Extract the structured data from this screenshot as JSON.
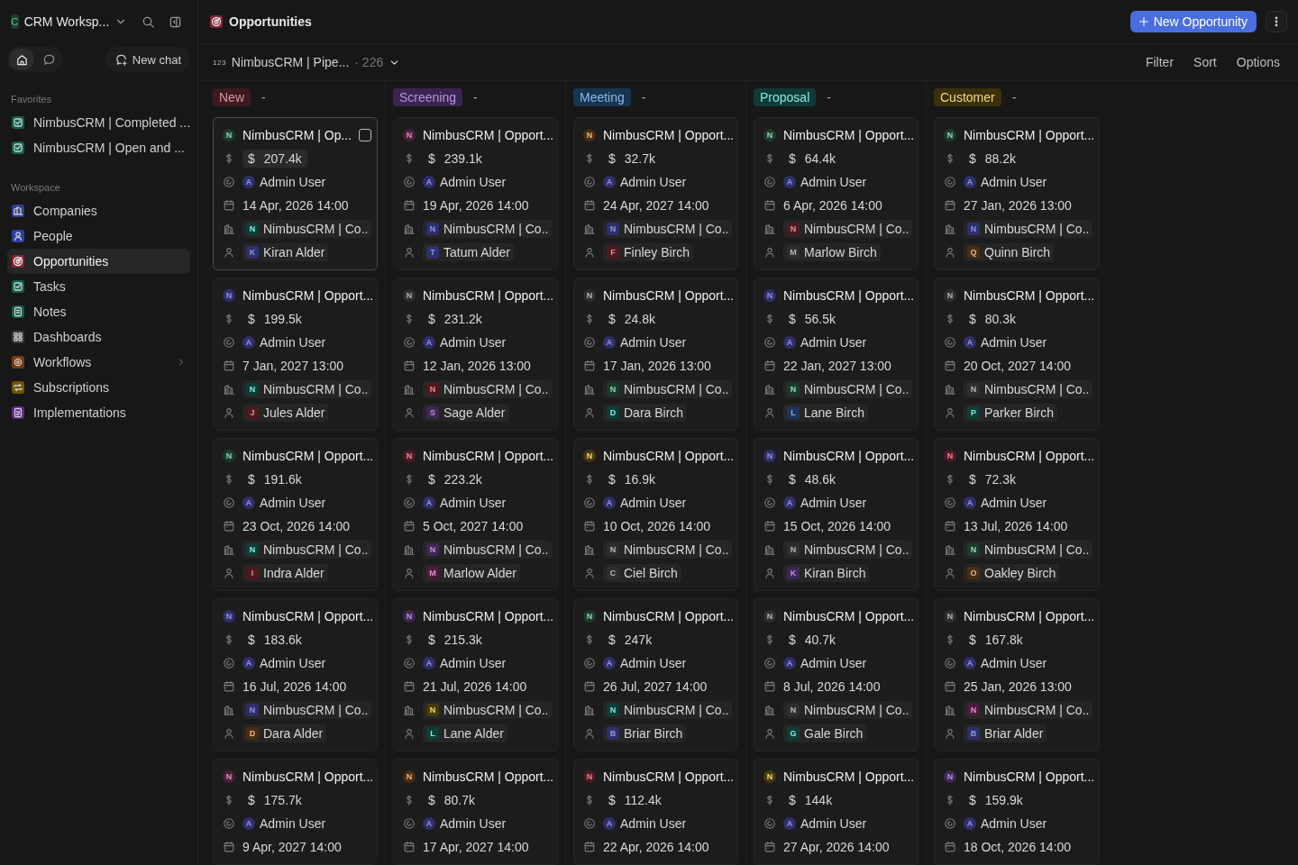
{
  "workspace": {
    "initial": "C",
    "name": "CRM Worksp..."
  },
  "sidebar": {
    "modes": [
      {
        "kind": "home",
        "selected": true
      },
      {
        "kind": "chat",
        "selected": false
      }
    ],
    "new_chat": "New chat",
    "favorites_label": "Favorites",
    "favorites": [
      {
        "label": "NimbusCRM | Completed ..."
      },
      {
        "label": "NimbusCRM | Open and ..."
      }
    ],
    "workspace_label": "Workspace",
    "items": [
      {
        "label": "Companies",
        "color": "#2f3f8f",
        "selected": false,
        "expandable": false
      },
      {
        "label": "People",
        "color": "#2c40a0",
        "selected": false,
        "expandable": false
      },
      {
        "label": "Opportunities",
        "color": "#8a2233",
        "selected": true,
        "expandable": false
      },
      {
        "label": "Tasks",
        "color": "#11604f",
        "selected": false,
        "expandable": false
      },
      {
        "label": "Notes",
        "color": "#0f5a48",
        "selected": false,
        "expandable": false
      },
      {
        "label": "Dashboards",
        "color": "#3a3a3a",
        "selected": false,
        "expandable": false
      },
      {
        "label": "Workflows",
        "color": "#7a3a10",
        "selected": false,
        "expandable": true
      },
      {
        "label": "Subscriptions",
        "color": "#6e5208",
        "selected": false,
        "expandable": false
      },
      {
        "label": "Implementations",
        "color": "#5a2a86",
        "selected": false,
        "expandable": false
      }
    ]
  },
  "header": {
    "title": "Opportunities",
    "new_button": "New Opportunity"
  },
  "view_bar": {
    "view_icon": "123",
    "view_name": "NimbusCRM | Pipe...",
    "count": "· 226",
    "actions": [
      "Filter",
      "Sort",
      "Options"
    ]
  },
  "currency": "$",
  "columns": [
    {
      "label": "New",
      "color": "#3d1a1e",
      "aggregate": "-",
      "cards": [
        {
          "hovered": true,
          "initial": "N",
          "color": "#1c3b2a",
          "title": "NimbusCRM | Op...",
          "amount": "207.4k",
          "owner": {
            "initial": "A",
            "color": "#2e2f6b",
            "name": "Admin User"
          },
          "date": "14 Apr, 2026 14:00",
          "company": {
            "initial": "N",
            "color": "#0f3d38",
            "name": "NimbusCRM | Co.."
          },
          "contact": {
            "initial": "K",
            "color": "#2e2f6b",
            "name": "Kiran Alder"
          }
        },
        {
          "hovered": false,
          "initial": "N",
          "color": "#2e2f6b",
          "title": "NimbusCRM | Opport...",
          "amount": "199.5k",
          "owner": {
            "initial": "A",
            "color": "#2e2f6b",
            "name": "Admin User"
          },
          "date": "7 Jan, 2027 13:00",
          "company": {
            "initial": "N",
            "color": "#0f3d38",
            "name": "NimbusCRM | Co.."
          },
          "contact": {
            "initial": "J",
            "color": "#4d1a20",
            "name": "Jules Alder"
          }
        },
        {
          "hovered": false,
          "initial": "N",
          "color": "#1c3b2a",
          "title": "NimbusCRM | Opport...",
          "amount": "191.6k",
          "owner": {
            "initial": "A",
            "color": "#2e2f6b",
            "name": "Admin User"
          },
          "date": "23 Oct, 2026 14:00",
          "company": {
            "initial": "N",
            "color": "#0f3d38",
            "name": "NimbusCRM | Co.."
          },
          "contact": {
            "initial": "I",
            "color": "#4d1a20",
            "name": "Indra Alder"
          }
        },
        {
          "hovered": false,
          "initial": "N",
          "color": "#2e2f6b",
          "title": "NimbusCRM | Opport...",
          "amount": "183.6k",
          "owner": {
            "initial": "A",
            "color": "#2e2f6b",
            "name": "Admin User"
          },
          "date": "16 Jul, 2026 14:00",
          "company": {
            "initial": "N",
            "color": "#2e2f6b",
            "name": "NimbusCRM | Co.."
          },
          "contact": {
            "initial": "D",
            "color": "#4a2c12",
            "name": "Dara Alder"
          }
        },
        {
          "hovered": false,
          "initial": "N",
          "color": "#4a1d3a",
          "title": "NimbusCRM | Opport...",
          "amount": "175.7k",
          "owner": {
            "initial": "A",
            "color": "#2e2f6b",
            "name": "Admin User"
          },
          "date": "9 Apr, 2027 14:00"
        }
      ]
    },
    {
      "label": "Screening",
      "color": "#3a2452",
      "aggregate": "-",
      "cards": [
        {
          "hovered": false,
          "initial": "N",
          "color": "#4a1d3a",
          "title": "NimbusCRM | Opport...",
          "amount": "239.1k",
          "owner": {
            "initial": "A",
            "color": "#2e2f6b",
            "name": "Admin User"
          },
          "date": "19 Apr, 2026 14:00",
          "company": {
            "initial": "N",
            "color": "#2e2f6b",
            "name": "NimbusCRM | Co.."
          },
          "contact": {
            "initial": "T",
            "color": "#2e2f6b",
            "name": "Tatum Alder"
          }
        },
        {
          "hovered": false,
          "initial": "N",
          "color": "#2e2e2e",
          "title": "NimbusCRM | Opport...",
          "amount": "231.2k",
          "owner": {
            "initial": "A",
            "color": "#2e2f6b",
            "name": "Admin User"
          },
          "date": "12 Jan, 2026 13:00",
          "company": {
            "initial": "N",
            "color": "#4d1a20",
            "name": "NimbusCRM | Co.."
          },
          "contact": {
            "initial": "S",
            "color": "#3d2754",
            "name": "Sage Alder"
          }
        },
        {
          "hovered": false,
          "initial": "N",
          "color": "#4d1a20",
          "title": "NimbusCRM | Opport...",
          "amount": "223.2k",
          "owner": {
            "initial": "A",
            "color": "#2e2f6b",
            "name": "Admin User"
          },
          "date": "5 Oct, 2027 14:00",
          "company": {
            "initial": "N",
            "color": "#3d2754",
            "name": "NimbusCRM | Co.."
          },
          "contact": {
            "initial": "M",
            "color": "#4a1d3a",
            "name": "Marlow Alder"
          }
        },
        {
          "hovered": false,
          "initial": "N",
          "color": "#3d2754",
          "title": "NimbusCRM | Opport...",
          "amount": "215.3k",
          "owner": {
            "initial": "A",
            "color": "#2e2f6b",
            "name": "Admin User"
          },
          "date": "21 Jul, 2026 14:00",
          "company": {
            "initial": "N",
            "color": "#453a0c",
            "name": "NimbusCRM | Co.."
          },
          "contact": {
            "initial": "L",
            "color": "#0f3d38",
            "name": "Lane Alder"
          }
        },
        {
          "hovered": false,
          "initial": "N",
          "color": "#4a2c12",
          "title": "NimbusCRM | Opport...",
          "amount": "80.7k",
          "owner": {
            "initial": "A",
            "color": "#2e2f6b",
            "name": "Admin User"
          },
          "date": "17 Apr, 2027 14:00"
        }
      ]
    },
    {
      "label": "Meeting",
      "color": "#183552",
      "aggregate": "-",
      "cards": [
        {
          "hovered": false,
          "initial": "N",
          "color": "#4a2c12",
          "title": "NimbusCRM | Opport...",
          "amount": "32.7k",
          "owner": {
            "initial": "A",
            "color": "#2e2f6b",
            "name": "Admin User"
          },
          "date": "24 Apr, 2027 14:00",
          "company": {
            "initial": "N",
            "color": "#2e2f6b",
            "name": "NimbusCRM | Co.."
          },
          "contact": {
            "initial": "F",
            "color": "#4d1a20",
            "name": "Finley Birch"
          }
        },
        {
          "hovered": false,
          "initial": "N",
          "color": "#2e2e2e",
          "title": "NimbusCRM | Opport...",
          "amount": "24.8k",
          "owner": {
            "initial": "A",
            "color": "#2e2f6b",
            "name": "Admin User"
          },
          "date": "17 Jan, 2026 13:00",
          "company": {
            "initial": "N",
            "color": "#1c3b2a",
            "name": "NimbusCRM | Co.."
          },
          "contact": {
            "initial": "D",
            "color": "#0f3d38",
            "name": "Dara Birch"
          }
        },
        {
          "hovered": false,
          "initial": "N",
          "color": "#453a0c",
          "title": "NimbusCRM | Opport...",
          "amount": "16.9k",
          "owner": {
            "initial": "A",
            "color": "#2e2f6b",
            "name": "Admin User"
          },
          "date": "10 Oct, 2026 14:00",
          "company": {
            "initial": "N",
            "color": "#2e2e2e",
            "name": "NimbusCRM | Co.."
          },
          "contact": {
            "initial": "C",
            "color": "#2e2e2e",
            "name": "Ciel Birch"
          }
        },
        {
          "hovered": false,
          "initial": "N",
          "color": "#1c3b2a",
          "title": "NimbusCRM | Opport...",
          "amount": "247k",
          "owner": {
            "initial": "A",
            "color": "#2e2f6b",
            "name": "Admin User"
          },
          "date": "26 Jul, 2027 14:00",
          "company": {
            "initial": "N",
            "color": "#0f3d38",
            "name": "NimbusCRM | Co.."
          },
          "contact": {
            "initial": "B",
            "color": "#2e2f6b",
            "name": "Briar Birch"
          }
        },
        {
          "hovered": false,
          "initial": "N",
          "color": "#4d1a20",
          "title": "NimbusCRM | Opport...",
          "amount": "112.4k",
          "owner": {
            "initial": "A",
            "color": "#2e2f6b",
            "name": "Admin User"
          },
          "date": "22 Apr, 2026 14:00"
        }
      ]
    },
    {
      "label": "Proposal",
      "color": "#0f3a36",
      "aggregate": "-",
      "cards": [
        {
          "hovered": false,
          "initial": "N",
          "color": "#1c3b2a",
          "title": "NimbusCRM | Opport...",
          "amount": "64.4k",
          "owner": {
            "initial": "A",
            "color": "#2e2f6b",
            "name": "Admin User"
          },
          "date": "6 Apr, 2026 14:00",
          "company": {
            "initial": "N",
            "color": "#4d1a20",
            "name": "NimbusCRM | Co.."
          },
          "contact": {
            "initial": "M",
            "color": "#2e2e2e",
            "name": "Marlow Birch"
          }
        },
        {
          "hovered": false,
          "initial": "N",
          "color": "#2e2f6b",
          "title": "NimbusCRM | Opport...",
          "amount": "56.5k",
          "owner": {
            "initial": "A",
            "color": "#2e2f6b",
            "name": "Admin User"
          },
          "date": "22 Jan, 2027 13:00",
          "company": {
            "initial": "N",
            "color": "#1c3b2a",
            "name": "NimbusCRM | Co.."
          },
          "contact": {
            "initial": "L",
            "color": "#1d3557",
            "name": "Lane Birch"
          }
        },
        {
          "hovered": false,
          "initial": "N",
          "color": "#2e2f6b",
          "title": "NimbusCRM | Opport...",
          "amount": "48.6k",
          "owner": {
            "initial": "A",
            "color": "#2e2f6b",
            "name": "Admin User"
          },
          "date": "15 Oct, 2026 14:00",
          "company": {
            "initial": "N",
            "color": "#2e2e2e",
            "name": "NimbusCRM | Co.."
          },
          "contact": {
            "initial": "K",
            "color": "#3d2754",
            "name": "Kiran Birch"
          }
        },
        {
          "hovered": false,
          "initial": "N",
          "color": "#2e2e2e",
          "title": "NimbusCRM | Opport...",
          "amount": "40.7k",
          "owner": {
            "initial": "A",
            "color": "#2e2f6b",
            "name": "Admin User"
          },
          "date": "8 Jul, 2026 14:00",
          "company": {
            "initial": "N",
            "color": "#2e2e2e",
            "name": "NimbusCRM | Co.."
          },
          "contact": {
            "initial": "G",
            "color": "#0f3d38",
            "name": "Gale Birch"
          }
        },
        {
          "hovered": false,
          "initial": "N",
          "color": "#453a0c",
          "title": "NimbusCRM | Opport...",
          "amount": "144k",
          "owner": {
            "initial": "A",
            "color": "#2e2f6b",
            "name": "Admin User"
          },
          "date": "27 Apr, 2026 14:00"
        }
      ]
    },
    {
      "label": "Customer",
      "color": "#3a300a",
      "aggregate": "-",
      "cards": [
        {
          "hovered": false,
          "initial": "N",
          "color": "#1c3b2a",
          "title": "NimbusCRM | Opport...",
          "amount": "88.2k",
          "owner": {
            "initial": "A",
            "color": "#2e2f6b",
            "name": "Admin User"
          },
          "date": "27 Jan, 2026 13:00",
          "company": {
            "initial": "N",
            "color": "#2e2f6b",
            "name": "NimbusCRM | Co.."
          },
          "contact": {
            "initial": "Q",
            "color": "#4a2c12",
            "name": "Quinn Birch"
          }
        },
        {
          "hovered": false,
          "initial": "N",
          "color": "#2e2e2e",
          "title": "NimbusCRM | Opport...",
          "amount": "80.3k",
          "owner": {
            "initial": "A",
            "color": "#2e2f6b",
            "name": "Admin User"
          },
          "date": "20 Oct, 2027 14:00",
          "company": {
            "initial": "N",
            "color": "#2e2e2e",
            "name": "NimbusCRM | Co.."
          },
          "contact": {
            "initial": "P",
            "color": "#0f3d38",
            "name": "Parker Birch"
          }
        },
        {
          "hovered": false,
          "initial": "N",
          "color": "#4d1a20",
          "title": "NimbusCRM | Opport...",
          "amount": "72.3k",
          "owner": {
            "initial": "A",
            "color": "#2e2f6b",
            "name": "Admin User"
          },
          "date": "13 Jul, 2026 14:00",
          "company": {
            "initial": "N",
            "color": "#1c3b2a",
            "name": "NimbusCRM | Co.."
          },
          "contact": {
            "initial": "O",
            "color": "#4a2c12",
            "name": "Oakley Birch"
          }
        },
        {
          "hovered": false,
          "initial": "N",
          "color": "#2e2e2e",
          "title": "NimbusCRM | Opport...",
          "amount": "167.8k",
          "owner": {
            "initial": "A",
            "color": "#2e2f6b",
            "name": "Admin User"
          },
          "date": "25 Jan, 2026 13:00",
          "company": {
            "initial": "N",
            "color": "#4a1d3a",
            "name": "NimbusCRM | Co.."
          },
          "contact": {
            "initial": "B",
            "color": "#2e2f6b",
            "name": "Briar Alder"
          }
        },
        {
          "hovered": false,
          "initial": "N",
          "color": "#3d2754",
          "title": "NimbusCRM | Opport...",
          "amount": "159.9k",
          "owner": {
            "initial": "A",
            "color": "#2e2f6b",
            "name": "Admin User"
          },
          "date": "18 Oct, 2026 14:00"
        }
      ]
    }
  ]
}
